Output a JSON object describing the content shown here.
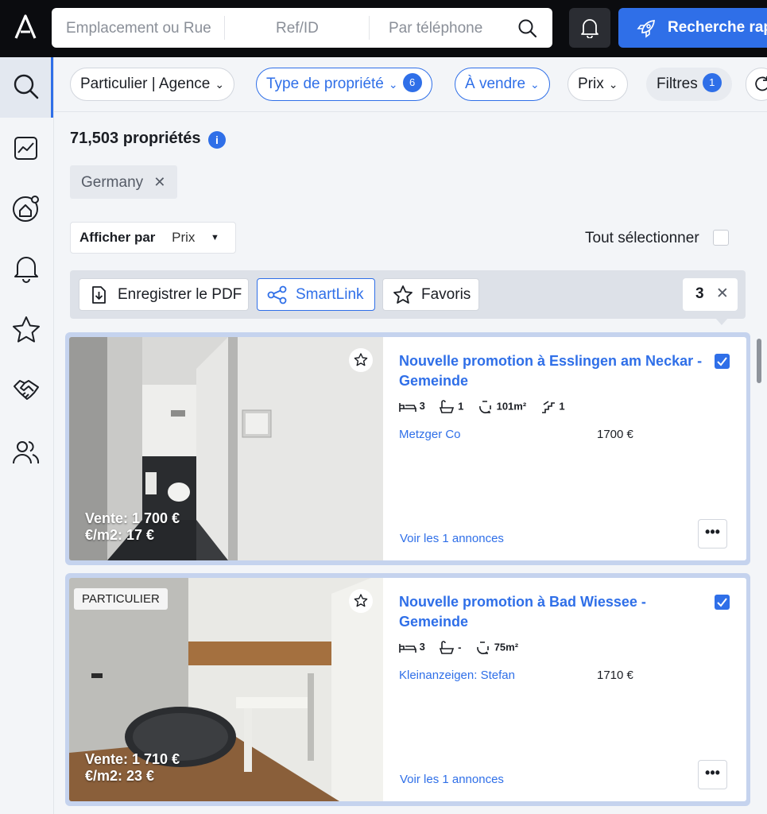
{
  "search": {
    "location_placeholder": "Emplacement ou Rue",
    "ref_placeholder": "Ref/ID",
    "phone_placeholder": "Par téléphone",
    "quick_search_label": "Recherche rapide"
  },
  "sidebar": {
    "items": [
      {
        "icon": "search-icon",
        "active": true
      },
      {
        "icon": "chart-icon"
      },
      {
        "icon": "home-target-icon"
      },
      {
        "icon": "bell-icon"
      },
      {
        "icon": "star-icon"
      },
      {
        "icon": "handshake-icon"
      },
      {
        "icon": "users-icon"
      }
    ]
  },
  "filters": {
    "seller": "Particulier | Agence",
    "property_type": "Type de propriété",
    "property_type_count": "6",
    "transaction": "À vendre",
    "price": "Prix",
    "more": "Filtres",
    "more_count": "1"
  },
  "results": {
    "count": "71,503 propriétés",
    "location_tag": "Germany",
    "sort_label": "Afficher par",
    "sort_value": "Prix",
    "select_all": "Tout sélectionner"
  },
  "actions": {
    "pdf": "Enregistrer le PDF",
    "smartlink": "SmartLink",
    "favorites": "Favoris",
    "selected_count": "3"
  },
  "listings": [
    {
      "title": "Nouvelle promotion à Esslingen am Neckar - Gemeinde",
      "beds": "3",
      "baths": "1",
      "area": "101m²",
      "floors": "1",
      "agent": "Metzger Co",
      "price": "1700 €",
      "overlay_sale": "Vente: 1 700 €",
      "overlay_sqm": "€/m2: 17 €",
      "see_all": "Voir les 1 annonces",
      "checked": true
    },
    {
      "title": "Nouvelle promotion à Bad Wiessee - Gemeinde",
      "tag": "PARTICULIER",
      "beds": "3",
      "baths": "-",
      "area": "75m²",
      "agent": "Kleinanzeigen: Stefan",
      "price": "1710 €",
      "overlay_sale": "Vente: 1 710 €",
      "overlay_sqm": "€/m2: 23 €",
      "see_all": "Voir les 1 annonces",
      "checked": true
    }
  ],
  "colors": {
    "accent": "#2f6fe8",
    "topbar": "#0b0c0f",
    "background": "#f3f5f8"
  }
}
